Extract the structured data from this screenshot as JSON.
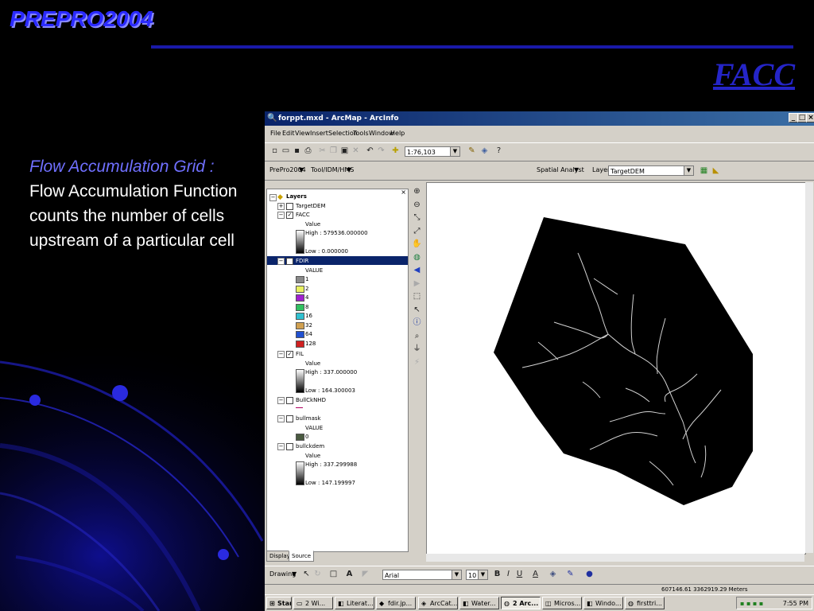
{
  "slide": {
    "header": "PREPRO2004",
    "title": "FACC",
    "lead": "Flow Accumulation Grid :",
    "body": "Flow Accumulation Function counts the number of cells upstream of a particular cell"
  },
  "colors": {
    "header_blue": "#2a2aff",
    "title_blue": "#2525c8",
    "lead_blue": "#7070ff",
    "titlebar": "#0a246a"
  },
  "window": {
    "title": "forppt.mxd - ArcMap - ArcInfo",
    "buttons": [
      "_",
      "□",
      "×"
    ],
    "menu": [
      "File",
      "Edit",
      "View",
      "Insert",
      "Selection",
      "Tools",
      "Window",
      "Help"
    ]
  },
  "toolbar": {
    "scale": "1:76,103",
    "prepro_menu": "PrePro2004",
    "tool_menu": "Tool/IDM/HMS",
    "spatial_analyst": "Spatial Analyst",
    "layer_label": "Layer:",
    "layer_value": "TargetDEM"
  },
  "toc": {
    "root": "Layers",
    "targetdem": "TargetDEM",
    "facc": {
      "name": "FACC",
      "field": "Value",
      "high": "High : 579536.000000",
      "low": "Low : 0.000000"
    },
    "fdir": {
      "name": "FDIR",
      "field": "VALUE",
      "classes": [
        {
          "label": "1",
          "color": "#8a8a8a"
        },
        {
          "label": "2",
          "color": "#e8f060"
        },
        {
          "label": "4",
          "color": "#a020d0"
        },
        {
          "label": "8",
          "color": "#30c060"
        },
        {
          "label": "16",
          "color": "#30c0d0"
        },
        {
          "label": "32",
          "color": "#d0a050"
        },
        {
          "label": "64",
          "color": "#2050d0"
        },
        {
          "label": "128",
          "color": "#d02020"
        }
      ]
    },
    "fil": {
      "name": "FIL",
      "field": "Value",
      "high": "High : 337.000000",
      "low": "Low : 164.300003"
    },
    "bullcknhd": "BullCkNHD",
    "bullmask": {
      "name": "bullmask",
      "field": "VALUE",
      "class": "0",
      "color": "#4a5a40"
    },
    "bullckdem": {
      "name": "bullckdem",
      "field": "Value",
      "high": "High : 337.299988",
      "low": "Low : 147.199997"
    },
    "tabs": [
      "Display",
      "Source"
    ]
  },
  "tool_icons": [
    "zoom-in-icon",
    "zoom-out-icon",
    "fixed-zoom-in-icon",
    "fixed-zoom-out-icon",
    "pan-icon",
    "full-extent-icon",
    "back-icon",
    "forward-icon",
    "select-features-icon",
    "select-elements-icon",
    "identify-icon",
    "find-icon",
    "measure-icon",
    "hyperlink-icon"
  ],
  "draw": {
    "drawing_menu": "Drawing",
    "font": "Arial",
    "size": "10",
    "bold": "B",
    "italic": "I",
    "underline": "U"
  },
  "status": {
    "coords": "607146.61  3362919.29 Meters"
  },
  "taskbar": {
    "start": "Start",
    "tasks": [
      "2 Wi...",
      "Literat...",
      "fdir.jp...",
      "ArcCat...",
      "Water...",
      "2 Arc...",
      "Micros...",
      "Windo...",
      "firsttri..."
    ],
    "clock": "7:55 PM"
  }
}
